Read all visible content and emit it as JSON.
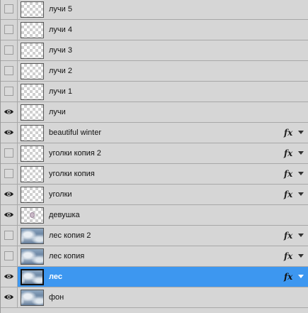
{
  "layers": [
    {
      "name": "лучи 5",
      "visible": false,
      "thumb": "transparent",
      "fx": false
    },
    {
      "name": "лучи 4",
      "visible": false,
      "thumb": "transparent",
      "fx": false
    },
    {
      "name": "лучи 3",
      "visible": false,
      "thumb": "transparent",
      "fx": false
    },
    {
      "name": "лучи 2",
      "visible": false,
      "thumb": "transparent",
      "fx": false
    },
    {
      "name": "лучи 1",
      "visible": false,
      "thumb": "transparent",
      "fx": false
    },
    {
      "name": "лучи",
      "visible": true,
      "thumb": "transparent",
      "fx": false
    },
    {
      "name": "beautiful winter",
      "visible": true,
      "thumb": "transparent",
      "fx": true
    },
    {
      "name": "уголки копия 2",
      "visible": false,
      "thumb": "transparent",
      "fx": true
    },
    {
      "name": "уголки копия",
      "visible": false,
      "thumb": "transparent",
      "fx": true
    },
    {
      "name": "уголки",
      "visible": true,
      "thumb": "transparent",
      "fx": true
    },
    {
      "name": "девушка",
      "visible": true,
      "thumb": "figure",
      "fx": false
    },
    {
      "name": "лес копия 2",
      "visible": false,
      "thumb": "photo",
      "fx": true
    },
    {
      "name": "лес копия",
      "visible": false,
      "thumb": "photo",
      "fx": true
    },
    {
      "name": "лес",
      "visible": true,
      "thumb": "photo",
      "fx": true,
      "selected": true
    },
    {
      "name": "фон",
      "visible": true,
      "thumb": "photo",
      "fx": false
    }
  ],
  "fx_label": "fx",
  "colors": {
    "selection": "#3d97f0",
    "panel": "#d6d6d6"
  }
}
